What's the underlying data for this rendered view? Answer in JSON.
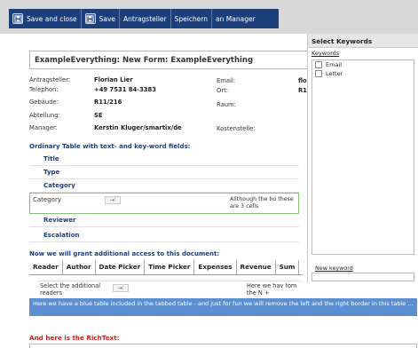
{
  "toolbar": {
    "buttons": [
      {
        "label": "Save and close",
        "icon": "save-icon"
      },
      {
        "label": "Save",
        "icon": "save-icon"
      },
      {
        "label": "Antragsteller"
      },
      {
        "label": "Speichern"
      },
      {
        "label": "an Manager"
      }
    ]
  },
  "form": {
    "title": "ExampleEverything: New Form: ExampleEverything",
    "fields": {
      "antragsteller_label": "Antragsteller:",
      "antragsteller_value": "Florian Lier",
      "telephon_label": "Telephon:",
      "telephon_value": "+49 7531 84-3383",
      "gebaeude_label": "Gebäude:",
      "gebaeude_value": "R11/216",
      "abteilung_label": "Abteilung:",
      "abteilung_value": "SE",
      "manager_label": "Manager:",
      "manager_value": "Kerstin Kluger/smartix/de",
      "email_label": "Email:",
      "email_value": "flo",
      "ort_label": "Ort:",
      "ort_value": "R1",
      "raum_label": "Raum:",
      "kostenstelle_label": "Kostenstelle:"
    },
    "ordinary_table_header": "Ordinary Table with text- and key-word fields:",
    "keyword_rows": [
      "Title",
      "Type",
      "Category"
    ],
    "category_row": {
      "label": "Category",
      "dropdown": "→∶",
      "note": "Allthough the bo these are 3 cells"
    },
    "keyword_rows_2": [
      "Reviewer",
      "Escalation"
    ],
    "access_header": "Now we will grant additional access to this document:",
    "tabs": [
      "Reader",
      "Author",
      "Date Picker",
      "Time Picker",
      "Expenses",
      "Revenue",
      "Sum"
    ],
    "readers": {
      "label": "Select the additional readers",
      "dropdown": "→∶",
      "note": "Here we hav fom the N +"
    },
    "blue_box": "Here we have a blue table included in the tabbed table - and just for fun we will remove the left and the right border in this table ...",
    "richtext_label": "And here is the RichText:"
  },
  "keyword_panel": {
    "title": "Select Keywords",
    "keywords_label": "Keywords",
    "items": [
      "Email",
      "Letter"
    ],
    "new_keyword_label": "New keyword"
  },
  "colors": {
    "toolbar_bg": "#1c3f7a",
    "section_header": "#1c3f7a",
    "blue_box": "#5c8fd0",
    "richtext_label": "#d21c1c"
  }
}
